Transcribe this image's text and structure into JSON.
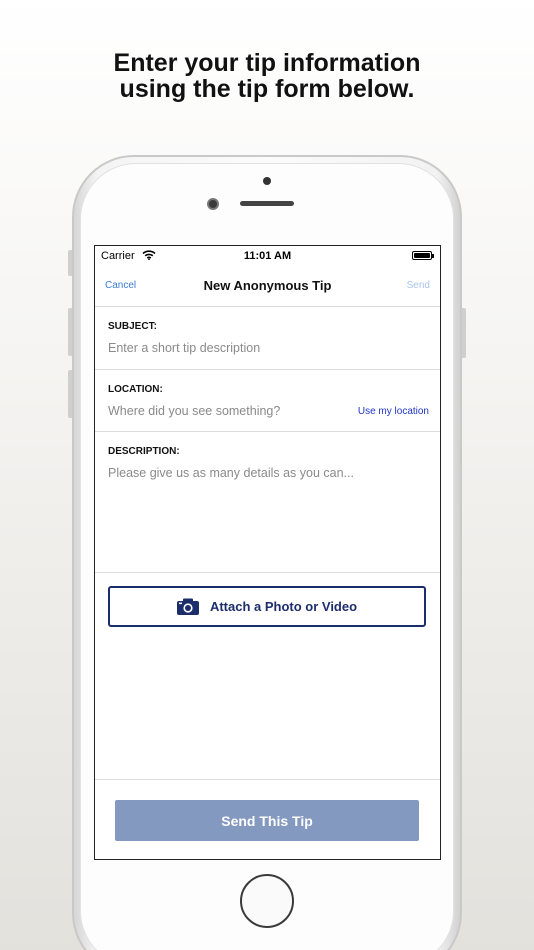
{
  "headline": {
    "line1": "Enter your tip information",
    "line2": "using the tip form below."
  },
  "status_bar": {
    "carrier": "Carrier",
    "wifi_icon": "wifi-icon",
    "time": "11:01 AM",
    "battery_icon": "battery-icon"
  },
  "nav": {
    "cancel": "Cancel",
    "title": "New Anonymous Tip",
    "send": "Send"
  },
  "form": {
    "subject": {
      "label": "SUBJECT:",
      "placeholder": "Enter a short tip description"
    },
    "location": {
      "label": "LOCATION:",
      "placeholder": "Where did you see something?",
      "use_location": "Use my location"
    },
    "description": {
      "label": "DESCRIPTION:",
      "placeholder": "Please give us as many details as you can..."
    }
  },
  "attach": {
    "label": "Attach a Photo or Video",
    "icon": "camera-icon"
  },
  "send_tip": {
    "label": "Send This Tip"
  },
  "colors": {
    "link_blue": "#3a7bd5",
    "disabled_send": "#a8c4ec",
    "navy": "#1c2d6b",
    "send_button": "#8499c0"
  }
}
